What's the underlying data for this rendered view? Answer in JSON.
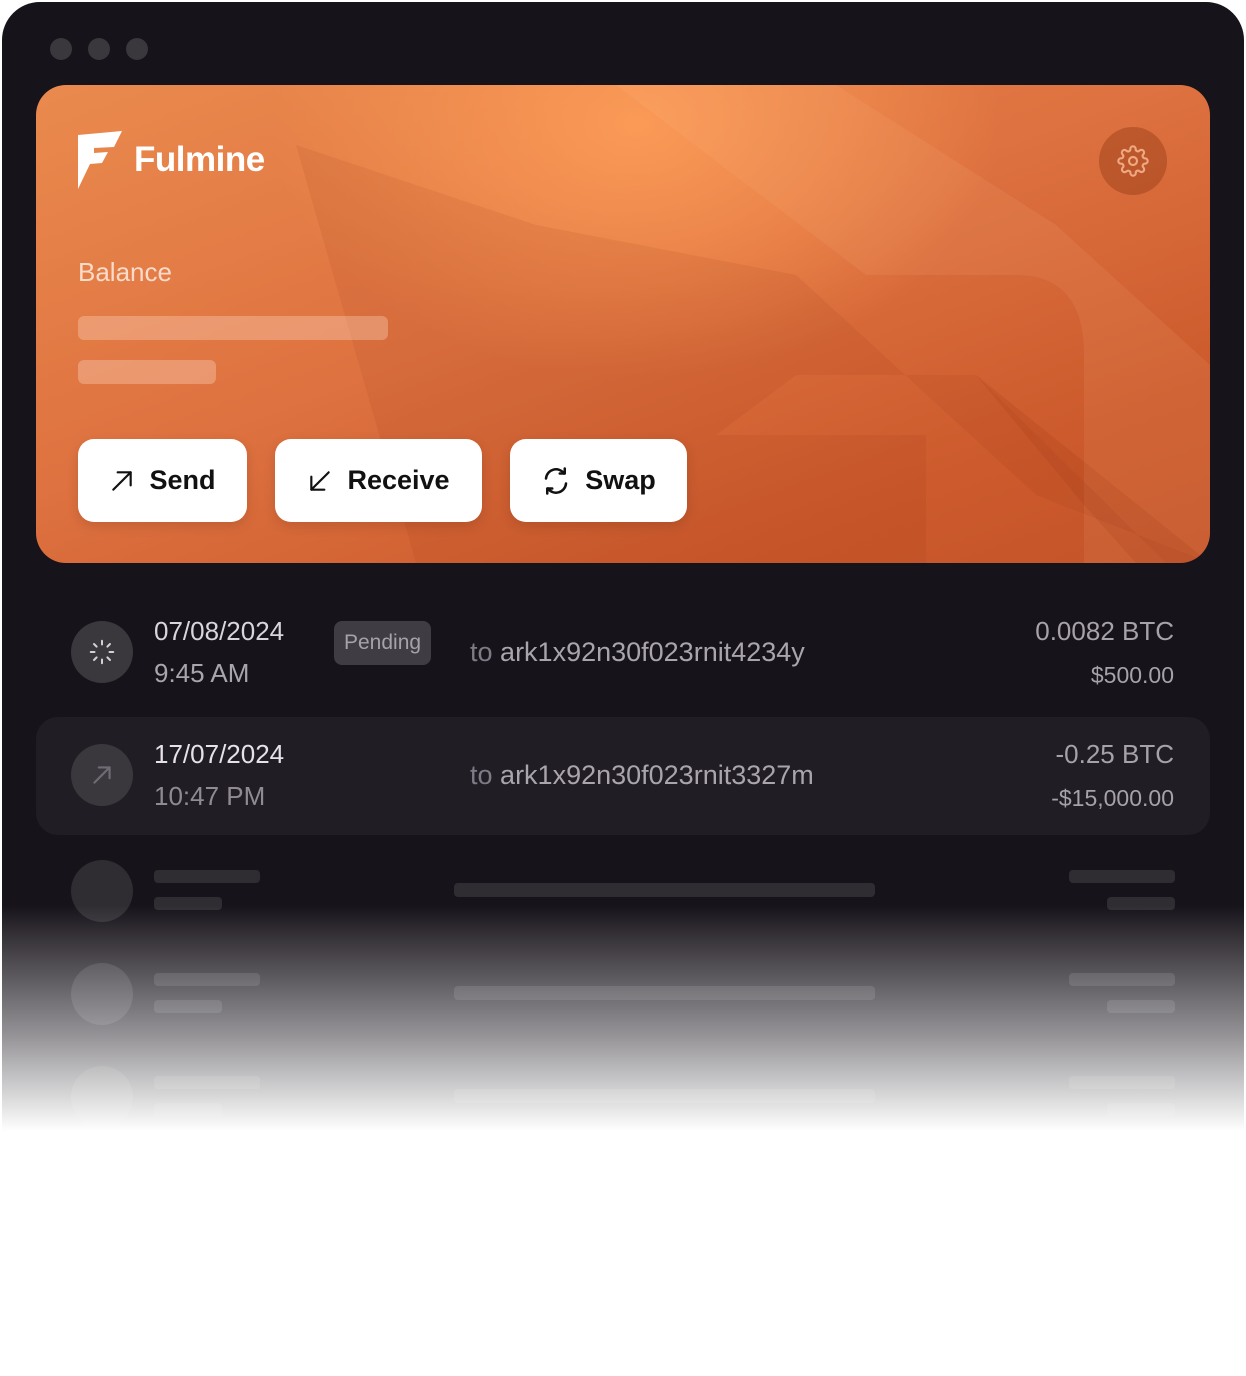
{
  "window": {
    "controls": [
      "close",
      "minimize",
      "maximize"
    ]
  },
  "card": {
    "brand": "Fulmine",
    "balance_label": "Balance",
    "settings_icon": "gear-icon",
    "colors": {
      "accent": "#E3753F",
      "accent_light": "#F79A59",
      "accent_dark": "#C4532A"
    }
  },
  "actions": {
    "send": {
      "label": "Send",
      "icon": "arrow-up-right-icon"
    },
    "receive": {
      "label": "Receive",
      "icon": "arrow-down-left-icon"
    },
    "swap": {
      "label": "Swap",
      "icon": "swap-icon"
    }
  },
  "transactions": [
    {
      "date": "07/08/2024",
      "time": "9:45 AM",
      "status": "Pending",
      "to_prefix": "to",
      "address": "ark1x92n30f023rnit4234y",
      "amount": "0.0082 BTC",
      "fiat": "$500.00",
      "icon": "spinner-icon"
    },
    {
      "date": "17/07/2024",
      "time": "10:47 PM",
      "to_prefix": "to",
      "address": "ark1x92n30f023rnit3327m",
      "amount": "-0.25 BTC",
      "fiat": "-$15,000.00",
      "icon": "arrow-up-right-icon"
    }
  ]
}
